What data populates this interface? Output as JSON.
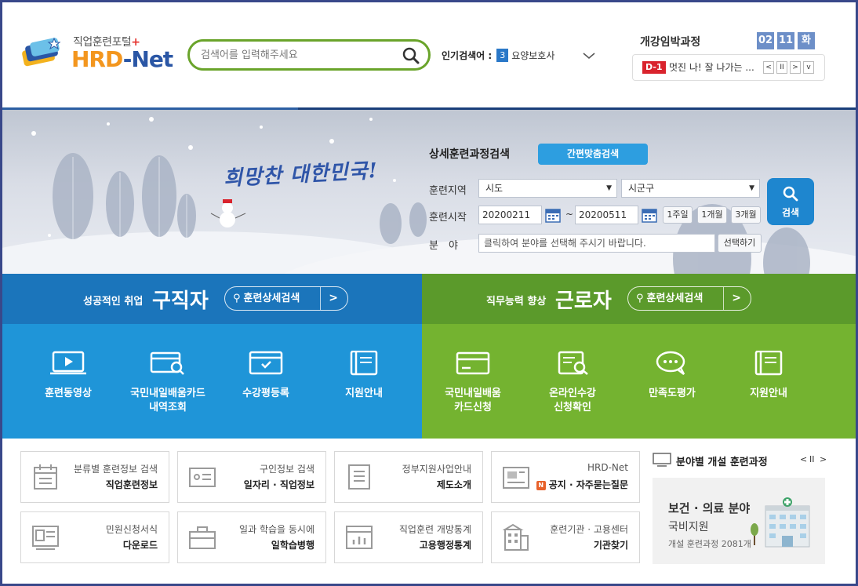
{
  "logo": {
    "subtitle": "직업훈련포털",
    "brand_hrd": "HRD",
    "brand_net": "-Net"
  },
  "search": {
    "placeholder": "검색어를 입력해주세요"
  },
  "popular": {
    "label": "인기검색어 :",
    "rank": "3",
    "keyword": "요양보호사"
  },
  "opening": {
    "title": "개강임박과정",
    "month": "02",
    "day": "11",
    "weekday": "화",
    "dday": "D-1",
    "course": "멋진 나! 잘 나가는 ..."
  },
  "hero": {
    "slogan": "희망찬 대한민국!",
    "form_title": "상세훈련과정검색",
    "quick_button": "간편맞춤검색",
    "region_label": "훈련지역",
    "region_select": "시도",
    "district_select": "시군구",
    "start_label": "훈련시작",
    "date_from": "20200211",
    "date_to": "20200511",
    "tilde": "~",
    "range_buttons": [
      "1주일",
      "1개월",
      "3개월"
    ],
    "field_label": "분　야",
    "field_placeholder": "클릭하여 분야를 선택해 주시기 바랍니다.",
    "select_button": "선택하기",
    "search_button": "검색"
  },
  "jobseeker": {
    "small": "성공적인 취업",
    "big": "구직자",
    "button": "훈련상세검색",
    "items": [
      "훈련동영상",
      "국민내일배움카드\n내역조회",
      "수강평등록",
      "지원안내"
    ]
  },
  "worker": {
    "small": "직무능력 향상",
    "big": "근로자",
    "button": "훈련상세검색",
    "items": [
      "국민내일배움\n카드신청",
      "온라인수강\n신청확인",
      "만족도평가",
      "지원안내"
    ]
  },
  "cards": [
    {
      "line1": "분류별 훈련정보 검색",
      "line2": "직업훈련정보",
      "icon": "calendar-icon"
    },
    {
      "line1": "구인정보 검색",
      "line2": "일자리 · 직업정보",
      "icon": "id-card-icon"
    },
    {
      "line1": "정부지원사업안내",
      "line2": "제도소개",
      "icon": "notebook-icon"
    },
    {
      "line1": "HRD-Net",
      "line2": "공지 · 자주묻는질문",
      "badge": "N",
      "icon": "news-icon"
    },
    {
      "line1": "민원신청서식",
      "line2": "다운로드",
      "icon": "download-form-icon"
    },
    {
      "line1": "일과 학습을 동시에",
      "line2": "일학습병행",
      "icon": "briefcase-icon"
    },
    {
      "line1": "직업훈련 개방통계",
      "line2": "고용행정통계",
      "icon": "chart-icon"
    },
    {
      "line1": "훈련기관 · 고용센터",
      "line2": "기관찾기",
      "icon": "building-icon"
    }
  ],
  "field_section": {
    "title": "분야별 개설 훈련과정",
    "line1": "보건 · 의료 분야",
    "line2": "국비지원",
    "line3": "개설 훈련과정 2081개"
  },
  "colors": {
    "jobseeker_head": "#1b75bb",
    "jobseeker_body": "#1f95d8",
    "worker_head": "#5b9a2b",
    "worker_body": "#74b330",
    "search_border": "#6aa42b",
    "accent_blue": "#2d9ee0"
  }
}
